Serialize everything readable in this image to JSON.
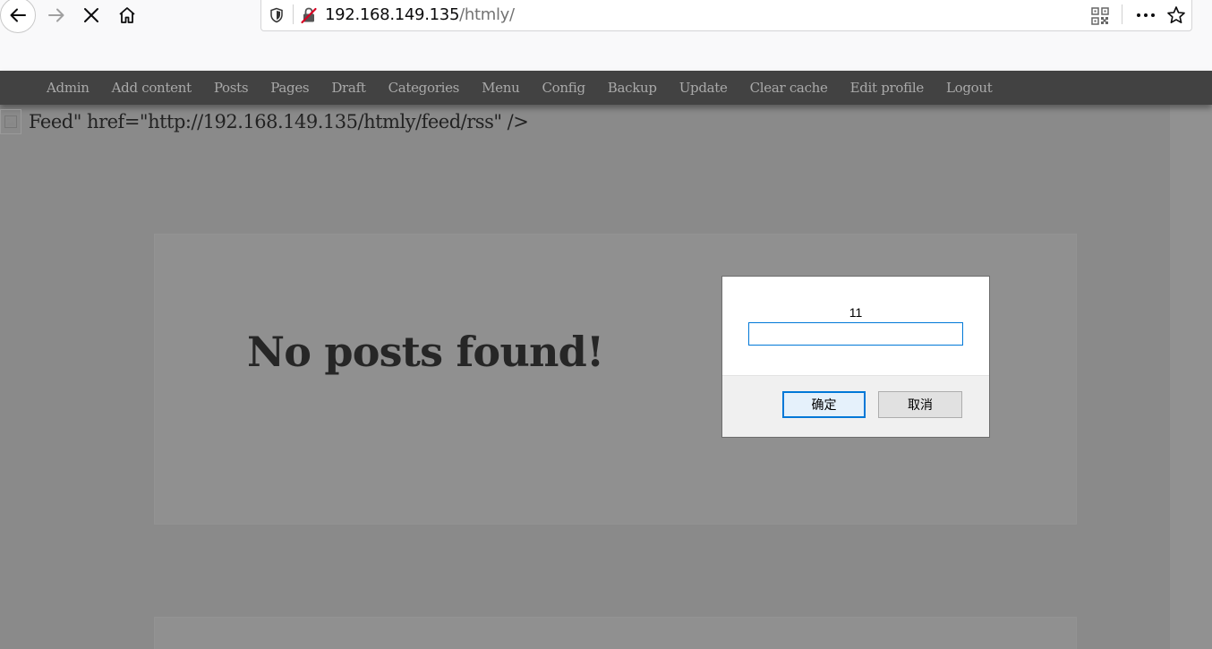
{
  "browser": {
    "url_host": "192.168.149.135",
    "url_path": "/htmly/",
    "icons": {
      "back": "arrow-left-icon",
      "forward": "arrow-right-icon",
      "stop": "close-icon",
      "home": "home-icon",
      "tracking": "shield-icon",
      "security": "insecure-lock-icon",
      "qr": "qr-code-icon",
      "more": "more-dots-icon",
      "bookmark": "star-icon"
    }
  },
  "admin_bar": {
    "links": [
      "Admin",
      "Add content",
      "Posts",
      "Pages",
      "Draft",
      "Categories",
      "Menu",
      "Config",
      "Backup",
      "Update",
      "Clear cache",
      "Edit profile",
      "Logout"
    ]
  },
  "page": {
    "feed_text": "Feed\" href=\"http://192.168.149.135/htmly/feed/rss\" />",
    "card_title": "No posts found!"
  },
  "dialog": {
    "message": "11",
    "input_value": "",
    "ok_label": "确定",
    "cancel_label": "取消"
  },
  "colors": {
    "admin_bar_bg": "#424242",
    "admin_link": "#a9a9a9",
    "page_overlay": "#8a8a8a",
    "dialog_accent": "#0078d7"
  }
}
